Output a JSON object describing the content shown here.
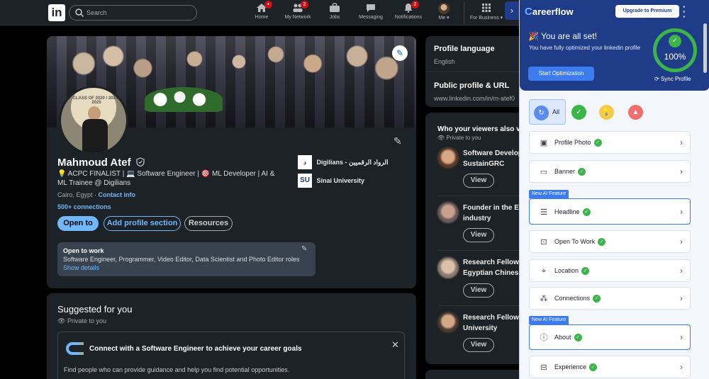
{
  "nav": {
    "logo": "in",
    "search_placeholder": "Search",
    "items": [
      {
        "label": "Home",
        "badge": "●"
      },
      {
        "label": "My Network",
        "badge": "2"
      },
      {
        "label": "Jobs",
        "badge": ""
      },
      {
        "label": "Messaging",
        "badge": ""
      },
      {
        "label": "Notifications",
        "badge": "2"
      },
      {
        "label": "Me ▾",
        "badge": ""
      },
      {
        "label": "For Business ▾",
        "badge": ""
      }
    ]
  },
  "profile": {
    "name": "Mahmoud Atef",
    "headline": "💡 ACPC FINALIST | 💻 Software Engineer | 🎯 ML Developer | AI & ML Trainee @ Digilians",
    "location": "Cairo, Egypt · ",
    "contact_info": "Contact info",
    "connections": "500+ connections",
    "open_to_btn": "Open to",
    "add_section_btn": "Add profile section",
    "resources_btn": "Resources",
    "cover_text": "CLASS OF 2020 / 2024 / 2025",
    "companies": [
      {
        "logo": "د",
        "name": "Digilians - الرواد الرقميين"
      },
      {
        "logo": "SU",
        "name": "Sinai University"
      }
    ],
    "open_to_work": {
      "title": "Open to work",
      "roles": "Software Engineer, Programmer, Video Editor, Data Scientist and Photo Editor roles",
      "details": "Show details"
    }
  },
  "suggested": {
    "title": "Suggested for you",
    "private": "Private to you",
    "card_title": "Connect with a Software Engineer to achieve your career goals",
    "card_text": "Find people who can provide guidance and help you find potential opportunities."
  },
  "right": {
    "profile_language_title": "Profile language",
    "profile_language_value": "English",
    "public_profile_title": "Public profile & URL",
    "public_profile_value": "www.linkedin.com/in/m-atef0",
    "viewers_title": "Who your viewers also vi",
    "viewers_private": "Private to you",
    "viewers": [
      {
        "line1": "Software Develop",
        "line2": "SustainGRC"
      },
      {
        "line1": "Founder in the Ec",
        "line2": "industry"
      },
      {
        "line1": "Research Fellow a",
        "line2": "Egyptian Chinese"
      },
      {
        "line1": "Research Fellow a",
        "line2": "University"
      }
    ],
    "view_btn": "View"
  },
  "careerflow": {
    "logo": "areerflow",
    "upgrade": "Upgrade to Premium",
    "all_set": "You are all set!",
    "optimized": "You have fully optimized your linkedin profile",
    "start_btn": "Start Optimization",
    "score": "100%",
    "sync": "Sync Profile",
    "filter_all": "All",
    "ai_tag": "New AI Feature",
    "items": [
      {
        "label": "Profile Photo"
      },
      {
        "label": "Banner"
      },
      {
        "label": "Headline"
      },
      {
        "label": "Open To Work"
      },
      {
        "label": "Location"
      },
      {
        "label": "Connections"
      },
      {
        "label": "About"
      },
      {
        "label": "Experience"
      }
    ],
    "colors": {
      "primary": "#1f3c88",
      "accent": "#3d7bf0",
      "success": "#3bb54a",
      "warning": "#f7c948",
      "danger": "#f26d6d"
    }
  }
}
